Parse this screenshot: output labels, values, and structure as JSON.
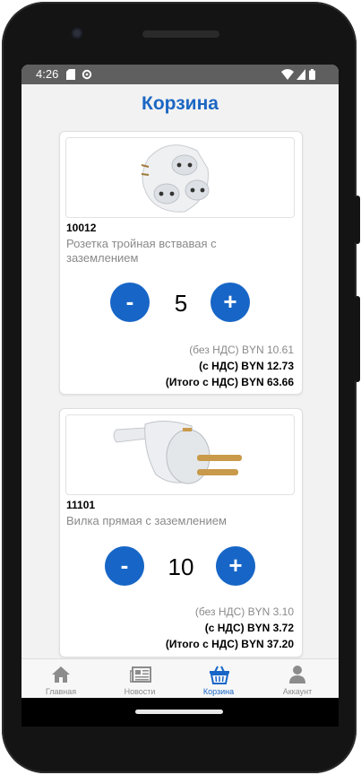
{
  "status_bar": {
    "time": "4:26"
  },
  "page": {
    "title": "Корзина"
  },
  "cart": {
    "items": [
      {
        "sku": "10012",
        "name": "Розетка тройная вствавая с заземлением",
        "quantity": "5",
        "minus_label": "-",
        "plus_label": "+",
        "price_no_vat": "(без НДС) BYN 10.61",
        "price_with_vat": "(с НДС) BYN 12.73",
        "total_with_vat": "(Итого с НДС) BYN 63.66"
      },
      {
        "sku": "11101",
        "name": "Вилка прямая с заземлением",
        "quantity": "10",
        "minus_label": "-",
        "plus_label": "+",
        "price_no_vat": "(без НДС) BYN 3.10",
        "price_with_vat": "(с НДС) BYN 3.72",
        "total_with_vat": "(Итого с НДС) BYN 37.20"
      }
    ]
  },
  "tabs": [
    {
      "label": "Главная",
      "icon": "home-icon",
      "active": false
    },
    {
      "label": "Новости",
      "icon": "newspaper-icon",
      "active": false
    },
    {
      "label": "Корзина",
      "icon": "basket-icon",
      "active": true
    },
    {
      "label": "Аккаунт",
      "icon": "user-icon",
      "active": false
    }
  ],
  "colors": {
    "accent": "#1766c7",
    "title": "#1b67c3",
    "screen_bg": "#f2f2f2",
    "status_bar": "#5f5f5f"
  }
}
